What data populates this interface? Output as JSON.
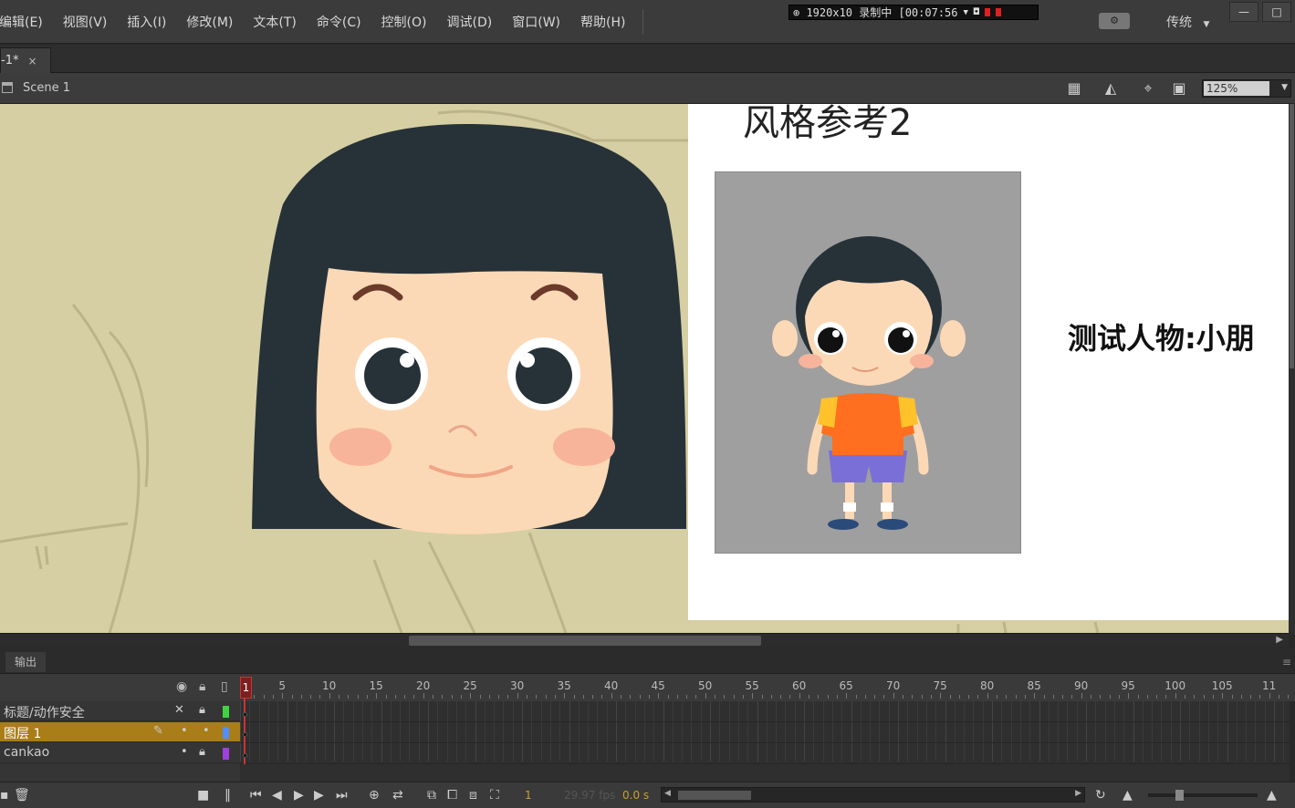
{
  "menu": {
    "items": [
      "编辑(E)",
      "视图(V)",
      "插入(I)",
      "修改(M)",
      "文本(T)",
      "命令(C)",
      "控制(O)",
      "调试(D)",
      "窗口(W)",
      "帮助(H)"
    ]
  },
  "recorder": {
    "text": "⊕ 1920x10 录制中 [00:07:56"
  },
  "workspace": {
    "label": "传统",
    "gear_label": "⚙"
  },
  "window_controls": {
    "minimize": "—",
    "maximize": "□"
  },
  "document": {
    "tab_label": "-1*",
    "close": "×"
  },
  "scene": {
    "name": "Scene 1",
    "zoom": "125%"
  },
  "reference": {
    "title": "风格参考2",
    "caption": "测试人物:小朋"
  },
  "panel": {
    "tab": "输出",
    "menu": "≡"
  },
  "timeline": {
    "playhead_frame": "1",
    "ruler_numbers": [
      "5",
      "10",
      "15",
      "20",
      "25",
      "30",
      "35",
      "40",
      "45",
      "50",
      "55",
      "60",
      "65",
      "70",
      "75",
      "80",
      "85",
      "90",
      "95",
      "100",
      "105",
      "11"
    ],
    "layers": [
      {
        "name": "标题/动作安全",
        "color": "#3fd43f"
      },
      {
        "name": "图层 1",
        "color": "#4f8fff"
      },
      {
        "name": "cankao",
        "color": "#a040e0"
      }
    ],
    "footer": {
      "current_frame": "1",
      "fps": "29.97 fps",
      "time": "0.0 s"
    }
  },
  "colors": {
    "stage_bg": "#d6cfa3",
    "hair": "#263238",
    "skin": "#fcd9b6",
    "cheek": "#f7b49b",
    "layer_active": "#a97d18"
  }
}
